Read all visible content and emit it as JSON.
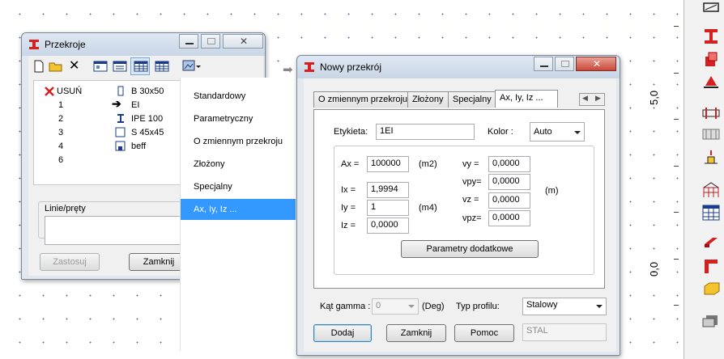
{
  "canvas": {
    "ruler_labels": [
      "5,0",
      "0,0"
    ]
  },
  "przekroje": {
    "title": "Przekroje",
    "list": [
      {
        "num": "USUŃ",
        "name": "B 30x50",
        "num_icon": "red-x-icon",
        "name_icon": "rectangle-section-icon"
      },
      {
        "num": "1",
        "name": "EI",
        "num_icon": "",
        "name_icon": "arrow-right-icon"
      },
      {
        "num": "2",
        "name": "IPE 100",
        "num_icon": "",
        "name_icon": "i-beam-icon"
      },
      {
        "num": "3",
        "name": "S 45x45",
        "num_icon": "",
        "name_icon": "square-section-icon"
      },
      {
        "num": "4",
        "name": "beff",
        "num_icon": "",
        "name_icon": "tee-section-icon"
      },
      {
        "num": "6",
        "name": "",
        "num_icon": "",
        "name_icon": ""
      }
    ],
    "linie_label": "Linie/pręty",
    "apply_label": "Zastosuj",
    "close_label": "Zamknij"
  },
  "menu": {
    "items": [
      "Standardowy",
      "Parametryczny",
      "O zmiennym przekroju",
      "Złożony",
      "Specjalny",
      "Ax, Iy, Iz ..."
    ],
    "selected_index": 5
  },
  "dialog": {
    "title": "Nowy przekrój",
    "tabs": [
      "O zmiennym przekroju",
      "Złożony",
      "Specjalny",
      "Ax, Iy, Iz ..."
    ],
    "active_tab": 3,
    "etykieta_label": "Etykieta:",
    "etykieta_value": "1EI",
    "kolor_label": "Kolor :",
    "kolor_value": "Auto",
    "ax_label": "Ax =",
    "ax_value": "100000",
    "unit_m2": "(m2)",
    "ix_label": "Ix =",
    "ix_value": "1,9994",
    "iy_label": "Iy =",
    "iy_value": "1",
    "unit_m4": "(m4)",
    "iz_label": "Iz =",
    "iz_value": "0,0000",
    "vy_label": "vy =",
    "vy_value": "0,0000",
    "vpy_label": "vpy=",
    "vpy_value": "0,0000",
    "vz_label": "vz =",
    "vz_value": "0,0000",
    "vpz_label": "vpz=",
    "vpz_value": "0,0000",
    "unit_m": "(m)",
    "params_label": "Parametry dodatkowe",
    "kat_label": "Kąt gamma :",
    "kat_value": "0",
    "kat_unit": "(Deg)",
    "typ_label": "Typ profilu:",
    "typ_value": "Stalowy",
    "add_label": "Dodaj",
    "close_label": "Zamknij",
    "help_label": "Pomoc",
    "material_value": "STAL"
  }
}
